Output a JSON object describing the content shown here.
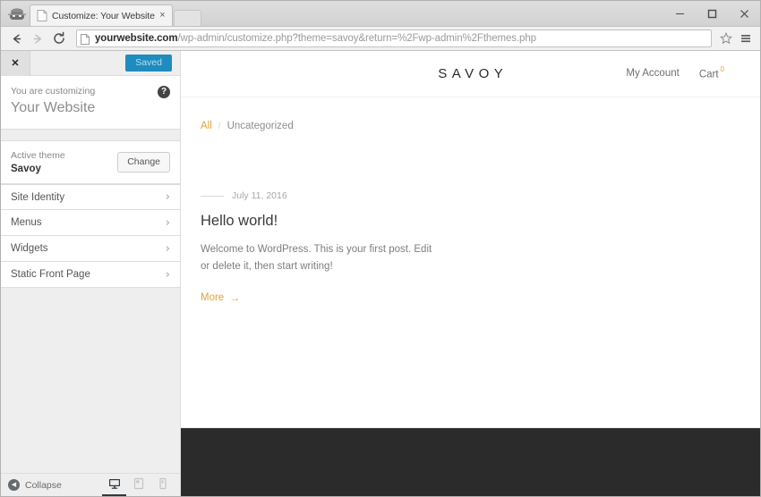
{
  "browser": {
    "tab": {
      "title": "Customize: Your Website -",
      "favicon_name": "page-icon",
      "close_glyph": "×"
    },
    "newtab_label": "",
    "window_controls": {
      "minimize": "–",
      "maximize": "☐",
      "close": "✕"
    },
    "nav": {
      "back": "←",
      "forward": "→",
      "reload": "⟳"
    },
    "address": {
      "domain": "yourwebsite.com",
      "path": "/wp-admin/customize.php?theme=savoy&return=%2Fwp-admin%2Fthemes.php"
    },
    "bookmark_glyph": "☆",
    "menu_glyph": "☰"
  },
  "customizer": {
    "close_glyph": "✕",
    "save_label": "Saved",
    "panel": {
      "eyebrow": "You are customizing",
      "title": "Your Website",
      "help_glyph": "?"
    },
    "theme": {
      "label": "Active theme",
      "name": "Savoy",
      "change_label": "Change"
    },
    "sections": [
      {
        "label": "Site Identity",
        "chevron": "›"
      },
      {
        "label": "Menus",
        "chevron": "›"
      },
      {
        "label": "Widgets",
        "chevron": "›"
      },
      {
        "label": "Static Front Page",
        "chevron": "›"
      }
    ],
    "footer": {
      "collapse_label": "Collapse",
      "collapse_glyph": "◀",
      "devices": [
        {
          "name": "desktop",
          "active": true
        },
        {
          "name": "tablet",
          "active": false
        },
        {
          "name": "mobile",
          "active": false
        }
      ]
    }
  },
  "site": {
    "logo": "SAVOY",
    "nav": [
      {
        "label": "My Account"
      }
    ],
    "cart": {
      "label": "Cart",
      "count": "0"
    },
    "filters": {
      "all": "All",
      "separator": "/",
      "category": "Uncategorized"
    },
    "post": {
      "date": "July 11, 2016",
      "title": "Hello world!",
      "excerpt": "Welcome to WordPress. This is your first post. Edit or delete it, then start writing!",
      "more_label": "More",
      "more_arrow": "→"
    }
  },
  "colors": {
    "accent": "#e0a23a",
    "save_button": "#1e8cbe",
    "footer": "#2b2b2b",
    "sidebar": "#eeeeee"
  }
}
